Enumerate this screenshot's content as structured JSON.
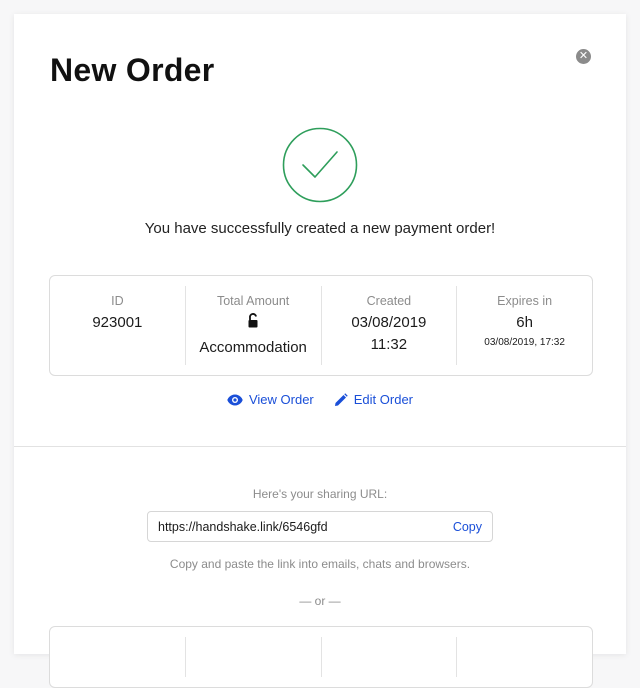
{
  "modal": {
    "title": "New Order",
    "close_icon": "close-circle-icon"
  },
  "status": {
    "icon": "check-circle-icon",
    "accent": "#2e9e5b",
    "message": "You have successfully created a new payment order!"
  },
  "order": {
    "id_label": "ID",
    "id_value": "923001",
    "amount_label": "Total Amount",
    "amount_icon": "lock-open-icon",
    "amount_value": "Accommodation",
    "created_label": "Created",
    "created_date": "03/08/2019",
    "created_time": "11:32",
    "expires_label": "Expires in",
    "expires_value": "6h",
    "expires_detail": "03/08/2019, 17:32"
  },
  "actions": {
    "view_label": "View Order",
    "view_icon": "eye-icon",
    "edit_label": "Edit Order",
    "edit_icon": "pencil-icon",
    "link_color": "#1a4fd8"
  },
  "share": {
    "label": "Here's your sharing URL:",
    "url": "https://handshake.link/6546gfd",
    "copy_label": "Copy",
    "hint": "Copy and paste the link into emails, chats and browsers.",
    "or_label": "— or —"
  }
}
